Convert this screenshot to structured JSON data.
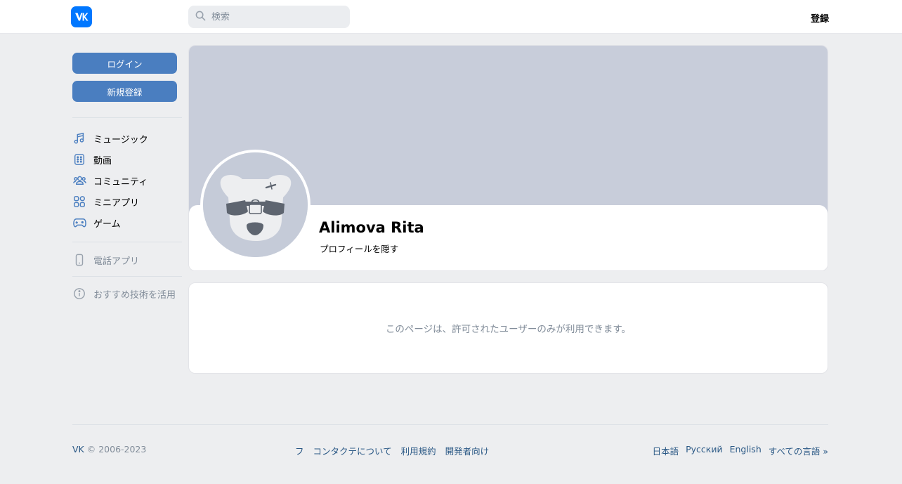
{
  "header": {
    "logo_icon": "vk-logo-icon",
    "search_placeholder": "検索",
    "register_label": "登録"
  },
  "sidebar": {
    "login_label": "ログイン",
    "signup_label": "新規登録",
    "items": [
      {
        "label": "ミュージック",
        "icon": "music-note-icon"
      },
      {
        "label": "動画",
        "icon": "video-icon"
      },
      {
        "label": "コミュニティ",
        "icon": "users-icon"
      },
      {
        "label": "ミニアプリ",
        "icon": "apps-grid-icon"
      },
      {
        "label": "ゲーム",
        "icon": "gamepad-icon"
      }
    ],
    "phone_app_label": "電話アプリ",
    "recommend_label": "おすすめ技術を活用"
  },
  "profile": {
    "name": "Alimova Rita",
    "hide_label": "プロフィールを隠す"
  },
  "private_notice": "このページは、許可されたユーザーのみが利用できます。",
  "footer": {
    "brand": "VK",
    "copyright": "© 2006-2023",
    "links": [
      "フ",
      "コンタクテについて",
      "利用規約",
      "開発者向け"
    ],
    "languages": [
      "日本語",
      "Русский",
      "English",
      "すべての言語 »"
    ]
  },
  "colors": {
    "brand_blue": "#0077ff",
    "button_blue": "#4a7ec0",
    "link_blue": "#2a5885",
    "muted_text": "#818c99",
    "cover_gray": "#c8cdda",
    "page_bg": "#edeef0"
  }
}
